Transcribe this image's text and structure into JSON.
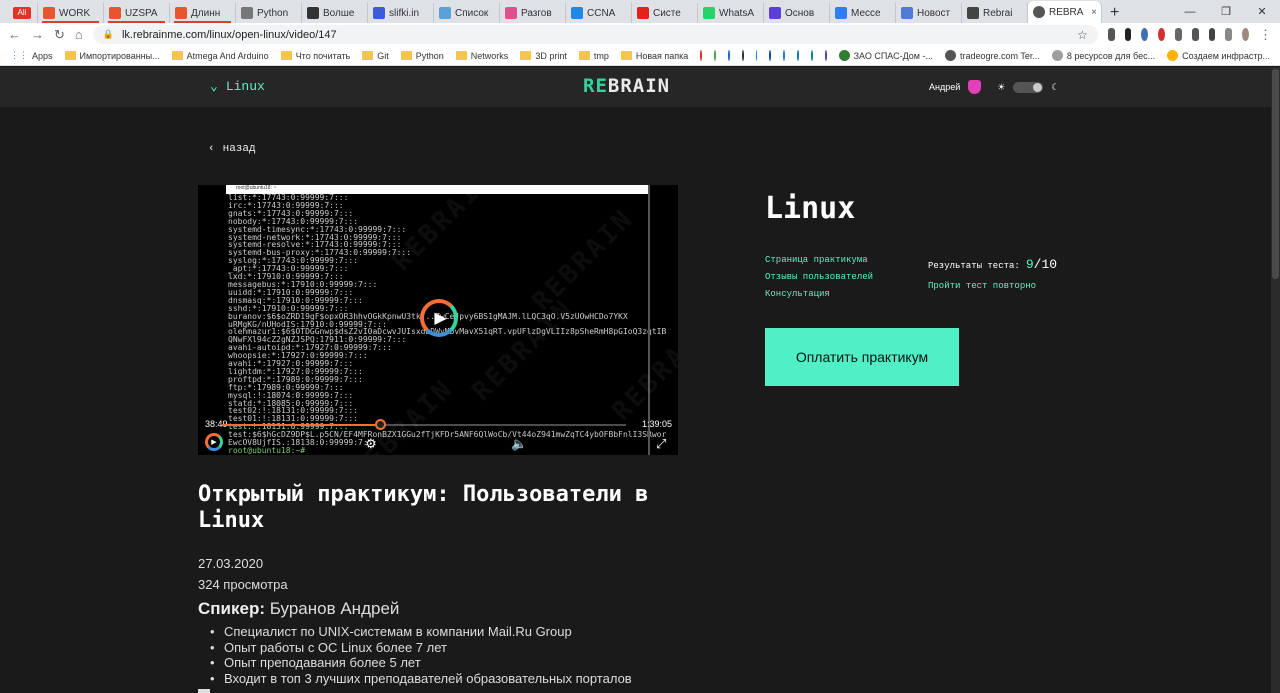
{
  "browser": {
    "tabs": [
      {
        "label": "AliExpress",
        "color": "#e43225",
        "icon_text": "Ali"
      },
      {
        "label": "WORK",
        "color": "#e8542b"
      },
      {
        "label": "UZSPA",
        "color": "#e8542b"
      },
      {
        "label": "Длинн",
        "color": "#e8542b"
      },
      {
        "label": "Python",
        "color": "#777777"
      },
      {
        "label": "Волше",
        "color": "#333333"
      },
      {
        "label": "slifki.in",
        "color": "#3b5bdb"
      },
      {
        "label": "Список",
        "color": "#5aa0d8"
      },
      {
        "label": "Разгов",
        "color": "#e04f8c"
      },
      {
        "label": "CCNA",
        "color": "#1e88e5"
      },
      {
        "label": "Систе",
        "color": "#e62117"
      },
      {
        "label": "WhatsA",
        "color": "#25d366"
      },
      {
        "label": "Основ",
        "color": "#5b3fd8"
      },
      {
        "label": "Мессе",
        "color": "#2d7ff9"
      },
      {
        "label": "Новост",
        "color": "#4f7ad6"
      },
      {
        "label": "Rebrai",
        "color": "#444444"
      }
    ],
    "active_tab": {
      "label": "REBRA"
    },
    "url": "lk.rebrainme.com/linux/open-linux/video/147",
    "bookmarks": [
      {
        "label": "Apps",
        "type": "apps"
      },
      {
        "label": "Импортированны...",
        "type": "folder"
      },
      {
        "label": "Atmega And Arduino",
        "type": "folder"
      },
      {
        "label": "Что почитать",
        "type": "folder"
      },
      {
        "label": "Git",
        "type": "folder"
      },
      {
        "label": "Python",
        "type": "folder"
      },
      {
        "label": "Networks",
        "type": "folder"
      },
      {
        "label": "3D print",
        "type": "folder"
      },
      {
        "label": "tmp",
        "type": "folder"
      },
      {
        "label": "Новая папка",
        "type": "folder"
      },
      {
        "label": "ЗАО СПАС-Дом -...",
        "type": "site"
      },
      {
        "label": "tradeogre.com Ter...",
        "type": "site"
      },
      {
        "label": "8 ресурсов для бес...",
        "type": "site"
      },
      {
        "label": "Создаем инфрастр...",
        "type": "site"
      }
    ]
  },
  "header": {
    "course": "Linux",
    "logo_re": "RE",
    "logo_brain": "BRAIN",
    "user_name": "Андрей"
  },
  "page": {
    "back_label": "назад",
    "video": {
      "current_time": "38:49",
      "duration": "1:39:05",
      "progress": 0.39,
      "terminal_title": "root@ubuntu18: ~",
      "terminal_lines": [
        "list:*:17743:0:99999:7:::",
        "irc:*:17743:0:99999:7:::",
        "gnats:*:17743:0:99999:7:::",
        "nobody:*:17743:0:99999:7:::",
        "systemd-timesync:*:17743:0:99999:7:::",
        "systemd-network:*:17743:0:99999:7:::",
        "systemd-resolve:*:17743:0:99999:7:::",
        "systemd-bus-proxy:*:17743:0:99999:7:::",
        "syslog:*:17743:0:99999:7:::",
        "_apt:*:17743:0:99999:7:::",
        "lxd:*:17910:0:99999:7:::",
        "messagebus:*:17910:0:99999:7:::",
        "uuidd:*:17910:0:99999:7:::",
        "dnsmasq:*:17910:0:99999:7:::",
        "sshd:*:17910:0:99999:7:::",
        "buranov:$6$oZRD19gF$opxOR3hhvOGkKpnwU3tkj..ZwCeJpvy6BS1gMAJM.lLQC3qO.V5zUOwHCDo7YKX",
        "uRMgKG/nUHodIS:17910:0:99999:7:::",
        "olehmazur1:$6$OTDGGnwp$dsZ2vI0aDcwvJUIsxdbDWyMbvMavX51qRT.vpUFlzDgVLIIz8pSheRmH8pGIoQ3zgtIB",
        "QNwFXl94cZ2gNZJSPQ:17911:0:99999:7:::",
        "avahi-autoipd:*:17927:0:99999:7:::",
        "whoopsie:*:17927:0:99999:7:::",
        "avahi:*:17927:0:99999:7:::",
        "lightdm:*:17927:0:99999:7:::",
        "proftpd:*:17989:0:99999:7:::",
        "ftp:*:17989:0:99999:7:::",
        "mysql:!:18074:0:99999:7:::",
        "statd:*:18085:0:99999:7:::",
        "test02:!:18131:0:99999:7:::",
        "test01:!:18131:0:99999:7:::",
        "test:!:18131:0:99999:7:::",
        "test:$6$hGcDZ9DP$L.p5CN/EF4MFRonBZX1GGu2fTjKFDr5ANF6QlWoCb/Vt44oZ941mwZqTC4ybOFBbFnlI3SRwor",
        "EwcOV8UjfIS.:18138:0:99999:7:::",
        "root@ubuntu18:~# "
      ],
      "watermark": "REBRAIN"
    },
    "title": "Открытый практикум: Пользователи в Linux",
    "date": "27.03.2020",
    "views": "324 просмотра",
    "speaker_label": "Спикер:",
    "speaker_name": "Буранов Андрей",
    "bio": [
      "Специалист по UNIX-системам в компании Mail.Ru Group",
      "Опыт работы с ОС Linux более 7 лет",
      "Опыт преподавания более 5 лет",
      "Входит в топ 3 лучших преподавателей образовательных порталов"
    ]
  },
  "sidebar": {
    "title": "Linux",
    "links": [
      "Страница практикума",
      "Отзывы пользователей",
      "Консультация"
    ],
    "result_label": "Результаты теста:",
    "score": "9",
    "score_total": "/10",
    "retake": "Пройти тест повторно",
    "pay_button": "Оплатить практикум"
  },
  "colors": {
    "accent": "#4ff0c6",
    "link": "#59f2c9",
    "background": "#1a1a1a",
    "header": "#262626",
    "video_progress": "#f56f35"
  }
}
